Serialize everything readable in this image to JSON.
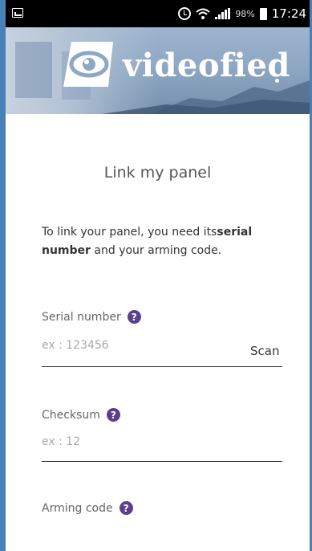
{
  "status_bar": {
    "battery_percent": "98%",
    "time": "17:24",
    "icons": [
      "screenshot-icon",
      "alarm-icon",
      "wifi-icon",
      "signal-icon",
      "battery-icon"
    ]
  },
  "header": {
    "logo_text": "videofied",
    "logo_icon": "eye-logo-icon"
  },
  "main": {
    "title": "Link my panel",
    "intro_prefix": "To link your panel, you need its",
    "intro_bold1": "serial number",
    "intro_middle": " and your arming code.",
    "fields": [
      {
        "label": "Serial number",
        "placeholder": "ex : 123456",
        "value": "",
        "help": "?",
        "action": "Scan"
      },
      {
        "label": "Checksum",
        "placeholder": "ex : 12",
        "value": "",
        "help": "?"
      },
      {
        "label": "Arming code",
        "placeholder": "",
        "value": "",
        "help": "?"
      }
    ]
  },
  "colors": {
    "help_badge": "#5b3f8f",
    "page_border": "#4a7fb8",
    "status_bar": "#000000"
  }
}
